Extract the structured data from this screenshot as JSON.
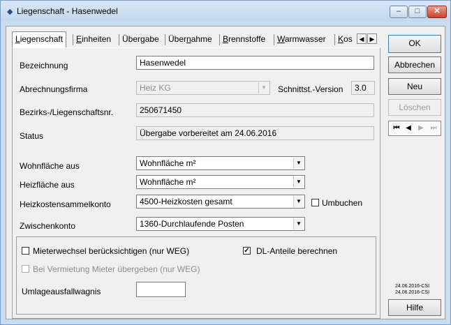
{
  "window": {
    "title": "Liegenschaft - Hasenwedel",
    "minimize": "–",
    "maximize": "□",
    "close": "✕"
  },
  "tabs": [
    {
      "label": "Liegenschaft",
      "key": "L",
      "rest": "iegenschaft"
    },
    {
      "label": "Einheiten",
      "key": "E",
      "rest": "inheiten"
    },
    {
      "label": "Übergabe",
      "pre": "Über",
      "key": "g",
      "rest": "abe"
    },
    {
      "label": "Übernahme",
      "pre": "Über",
      "key": "n",
      "rest": "ahme"
    },
    {
      "label": "Brennstoffe",
      "key": "B",
      "rest": "rennstoffe"
    },
    {
      "label": "Warmwasser",
      "key": "W",
      "rest": "armwasser"
    },
    {
      "label": "Kos",
      "key": "K",
      "rest": "os"
    }
  ],
  "tab_scroll": {
    "left": "◀",
    "right": "▶"
  },
  "form": {
    "bezeichnung": {
      "label": "Bezeichnung",
      "value": "Hasenwedel"
    },
    "abrechnungsfirma": {
      "label": "Abrechnungsfirma",
      "value": "Heiz KG"
    },
    "schnittstelle": {
      "label": "Schnittst.-Version",
      "value": "3.0"
    },
    "bezirk": {
      "label": "Bezirks-/Liegenschaftsnr.",
      "value": "250671450"
    },
    "status": {
      "label": "Status",
      "value": "Übergabe vorbereitet am 24.06.2016"
    },
    "wohnflaeche": {
      "label": "Wohnfläche aus",
      "value": "Wohnfläche m²"
    },
    "heizflaeche": {
      "label": "Heizfläche aus",
      "value": "Wohnfläche m²"
    },
    "heizkostenkonto": {
      "label": "Heizkostensammelkonto",
      "value": "4500-Heizkosten gesamt"
    },
    "umbuchen": {
      "label": "Umbuchen",
      "checked": false
    },
    "zwischenkonto": {
      "label": "Zwischenkonto",
      "value": "1360-Durchlaufende Posten"
    },
    "mieterwechsel": {
      "label": "Mieterwechsel berücksichtigen (nur WEG)",
      "checked": false
    },
    "dl_anteile": {
      "label": "DL-Anteile berechnen",
      "checked": true
    },
    "vermietung": {
      "label": "Bei Vermietung Mieter übergeben (nur WEG)",
      "checked": false
    },
    "umlageausfall": {
      "label": "Umlageausfallwagnis",
      "value": ""
    }
  },
  "buttons": {
    "ok": "OK",
    "abbrechen": "Abbrechen",
    "neu": "Neu",
    "loeschen": "Löschen",
    "hilfe": "Hilfe"
  },
  "navigator": {
    "first": "⏮",
    "prev": "◀",
    "next": "▶",
    "last": "⏭"
  },
  "version": {
    "line1": "24.06.2016-CSI",
    "line2": "24.06.2016-CSI"
  }
}
